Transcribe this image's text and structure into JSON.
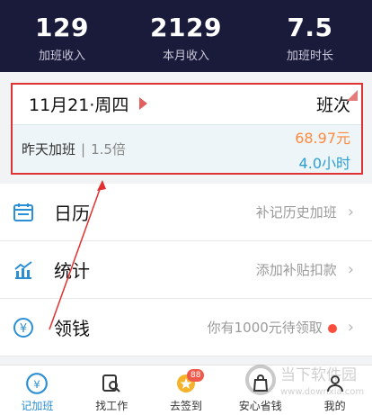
{
  "header": {
    "stats": [
      {
        "value": "129",
        "label": "加班收入"
      },
      {
        "value": "2129",
        "label": "本月收入"
      },
      {
        "value": "7.5",
        "label": "加班时长"
      }
    ]
  },
  "card": {
    "date": "11月21·周四",
    "shift": "班次",
    "yesterday": "昨天加班",
    "separator": "|",
    "rate": "1.5倍",
    "amount": "68.97元",
    "hours": "4.0小时"
  },
  "rows": [
    {
      "title": "日历",
      "hint": "补记历史加班",
      "icon": "calendar-icon"
    },
    {
      "title": "统计",
      "hint": "添加补贴扣款",
      "icon": "chart-icon"
    },
    {
      "title": "领钱",
      "hint": "你有1000元待领取",
      "icon": "yen-icon"
    }
  ],
  "nav": {
    "items": [
      {
        "label": "记加班",
        "icon": "overtime-icon",
        "active": true
      },
      {
        "label": "找工作",
        "icon": "search-job-icon"
      },
      {
        "label": "去签到",
        "icon": "checkin-icon",
        "badge": "88"
      },
      {
        "label": "安心省钱",
        "icon": "bag-icon"
      },
      {
        "label": "我的",
        "icon": "profile-icon"
      }
    ]
  },
  "watermark": {
    "text1": "当下软件园",
    "text2": "www.downxia.com"
  },
  "colors": {
    "header_bg": "#1a1a3a",
    "accent_blue": "#2b8fd6",
    "accent_orange": "#ff8a3d",
    "highlight_red": "#dd3333"
  }
}
